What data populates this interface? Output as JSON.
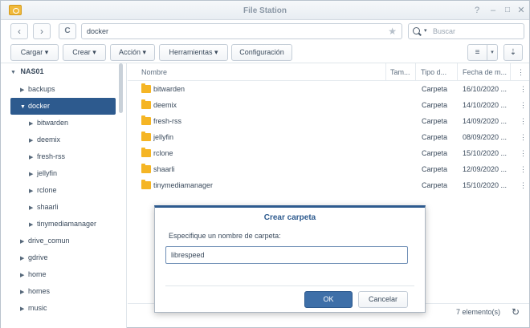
{
  "window": {
    "title": "File Station"
  },
  "nav": {
    "back": "‹",
    "forward": "›",
    "refresh": "C"
  },
  "path": {
    "value": "docker"
  },
  "search": {
    "placeholder": "Buscar"
  },
  "toolbar": {
    "cargar": "Cargar ▾",
    "crear": "Crear ▾",
    "accion": "Acción ▾",
    "herramientas": "Herramientas ▾",
    "configuracion": "Configuración"
  },
  "sidebar": {
    "root": "NAS01",
    "items": [
      {
        "label": "backups",
        "level": 1,
        "expanded": false,
        "selected": false
      },
      {
        "label": "docker",
        "level": 1,
        "expanded": true,
        "selected": true
      },
      {
        "label": "bitwarden",
        "level": 2,
        "expanded": false,
        "selected": false
      },
      {
        "label": "deemix",
        "level": 2,
        "expanded": false,
        "selected": false
      },
      {
        "label": "fresh-rss",
        "level": 2,
        "expanded": false,
        "selected": false
      },
      {
        "label": "jellyfin",
        "level": 2,
        "expanded": false,
        "selected": false
      },
      {
        "label": "rclone",
        "level": 2,
        "expanded": false,
        "selected": false
      },
      {
        "label": "shaarli",
        "level": 2,
        "expanded": false,
        "selected": false
      },
      {
        "label": "tinymediamanager",
        "level": 2,
        "expanded": false,
        "selected": false
      },
      {
        "label": "drive_comun",
        "level": 1,
        "expanded": false,
        "selected": false
      },
      {
        "label": "gdrive",
        "level": 1,
        "expanded": false,
        "selected": false
      },
      {
        "label": "home",
        "level": 1,
        "expanded": false,
        "selected": false
      },
      {
        "label": "homes",
        "level": 1,
        "expanded": false,
        "selected": false
      },
      {
        "label": "music",
        "level": 1,
        "expanded": false,
        "selected": false
      }
    ]
  },
  "filelist": {
    "columns": {
      "name": "Nombre",
      "size": "Tam...",
      "type": "Tipo d...",
      "date": "Fecha de m...",
      "more": "⋮"
    },
    "rows": [
      {
        "name": "bitwarden",
        "type": "Carpeta",
        "date": "16/10/2020 ..."
      },
      {
        "name": "deemix",
        "type": "Carpeta",
        "date": "14/10/2020 ..."
      },
      {
        "name": "fresh-rss",
        "type": "Carpeta",
        "date": "14/09/2020 ..."
      },
      {
        "name": "jellyfin",
        "type": "Carpeta",
        "date": "08/09/2020 ..."
      },
      {
        "name": "rclone",
        "type": "Carpeta",
        "date": "15/10/2020 ..."
      },
      {
        "name": "shaarli",
        "type": "Carpeta",
        "date": "12/09/2020 ..."
      },
      {
        "name": "tinymediamanager",
        "type": "Carpeta",
        "date": "15/10/2020 ..."
      }
    ]
  },
  "status": {
    "count": "7 elemento(s)"
  },
  "dialog": {
    "title": "Crear carpeta",
    "label": "Especifique un nombre de carpeta:",
    "input_value": "librespeed",
    "ok": "OK",
    "cancel": "Cancelar"
  },
  "colors": {
    "accent": "#2d5a8e",
    "folder": "#f5b524",
    "ok_button": "#3e6fa8"
  }
}
